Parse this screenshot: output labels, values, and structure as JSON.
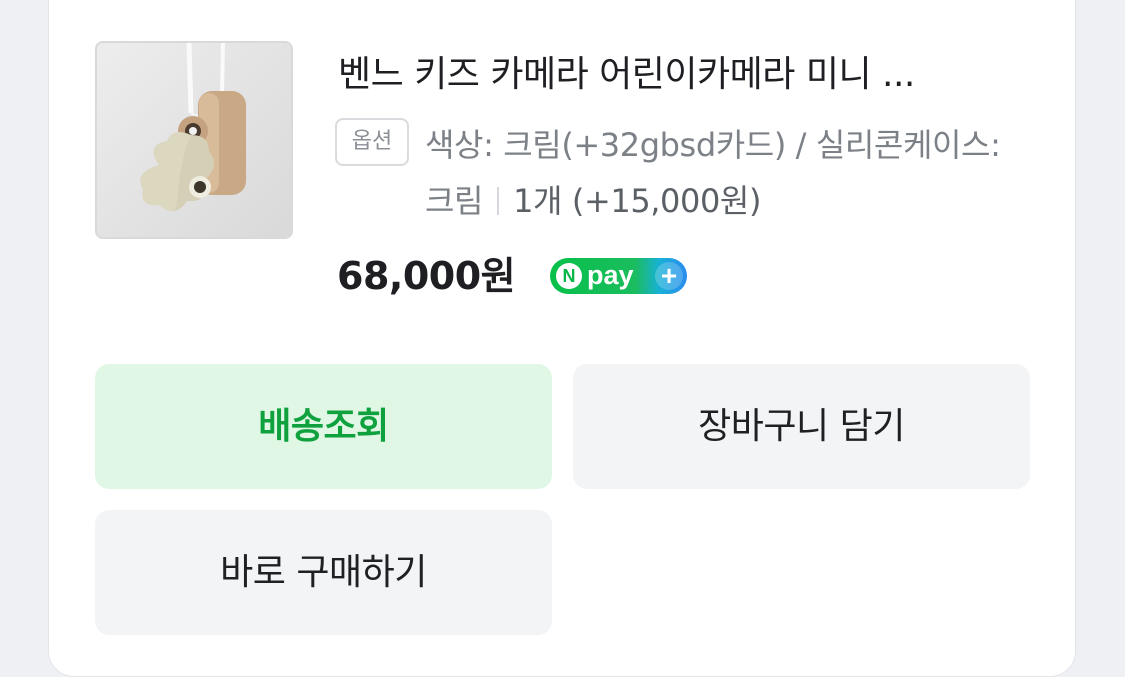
{
  "product": {
    "title": "벤느 키즈 카메라 어린이카메라 미니 ...",
    "option_badge": "옵션",
    "option_text": "색상: 크림(+32gbsd카드) / 실리콘케이스: 크림",
    "quantity_text": "1개 (+15,000원)",
    "price": "68,000원",
    "npay_badge": {
      "n_letter": "N",
      "word": "pay",
      "plus": "+"
    }
  },
  "actions": {
    "track_label": "배송조회",
    "cart_label": "장바구니 담기",
    "buy_label": "바로 구매하기"
  },
  "colors": {
    "track_bg": "#dff7e4",
    "track_text": "#10a13f",
    "neutral_bg": "#f3f4f6",
    "npay_green": "#08c04a",
    "npay_blue": "#2a8cf0"
  }
}
